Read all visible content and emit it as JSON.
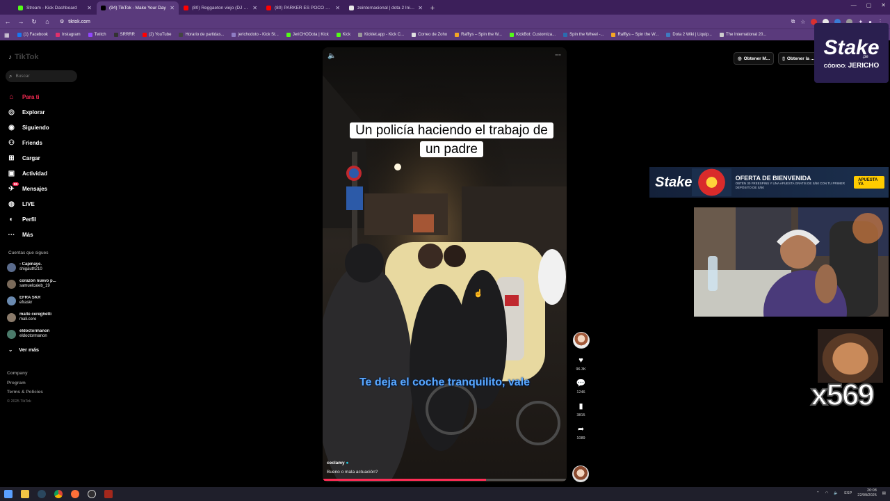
{
  "browser": {
    "tabs": [
      {
        "title": "Stream - Kick Dashboard",
        "color": "#53fc18",
        "active": false
      },
      {
        "title": "(94) TikTok - Make Your Day",
        "color": "#000000",
        "active": true
      },
      {
        "title": "(80) Reggaeton viejo (DJ Nina...",
        "color": "#ff0000",
        "active": false
      },
      {
        "title": "(80) PARKER ES POCO PROFESI...",
        "color": "#ff0000",
        "active": false
      },
      {
        "title": "zeinternacional | dota 2 Inicio",
        "color": "#e8e8e8",
        "active": false
      }
    ],
    "url": "tiktok.com",
    "bookmarks": [
      {
        "label": "(1) Facebook",
        "color": "#1877f2"
      },
      {
        "label": "Instagram",
        "color": "#e1306c"
      },
      {
        "label": "Twitch",
        "color": "#9146ff"
      },
      {
        "label": "SRRRR",
        "color": "#333333"
      },
      {
        "label": "(2) YouTube",
        "color": "#ff0000"
      },
      {
        "label": "Horario de partidas...",
        "color": "#444444"
      },
      {
        "label": "jerichodoto - Kick St...",
        "color": "#8e7cc3"
      },
      {
        "label": "JeriCHODota | Kick",
        "color": "#53fc18"
      },
      {
        "label": "Kick",
        "color": "#53fc18"
      },
      {
        "label": "Kicklet.app - Kick C...",
        "color": "#999999"
      },
      {
        "label": "Correo de Zoho",
        "color": "#e0e0e0"
      },
      {
        "label": "Rafflys – Spin the W...",
        "color": "#f5a623"
      },
      {
        "label": "KickBot: Customiza...",
        "color": "#53fc18"
      },
      {
        "label": "Spin the Wheel -...",
        "color": "#2b6cb0"
      },
      {
        "label": "Rafflys – Spin the W...",
        "color": "#f5a623"
      },
      {
        "label": "Dota 2 Wiki | Liquip...",
        "color": "#3f7ac1"
      },
      {
        "label": "The International 20...",
        "color": "#cccccc"
      }
    ]
  },
  "tiktok": {
    "logo": "TikTok",
    "search_placeholder": "Buscar",
    "nav": [
      {
        "label": "Para ti",
        "icon": "home-icon",
        "glyph": "⌂",
        "active": true
      },
      {
        "label": "Explorar",
        "icon": "compass-icon",
        "glyph": "◎",
        "active": false
      },
      {
        "label": "Siguiendo",
        "icon": "following-icon",
        "glyph": "◉",
        "active": false
      },
      {
        "label": "Friends",
        "icon": "friends-icon",
        "glyph": "⚇",
        "active": false
      },
      {
        "label": "Cargar",
        "icon": "upload-icon",
        "glyph": "⊞",
        "active": false
      },
      {
        "label": "Actividad",
        "icon": "activity-icon",
        "glyph": "▣",
        "active": false,
        "badge": ""
      },
      {
        "label": "Mensajes",
        "icon": "messages-icon",
        "glyph": "✈",
        "active": false,
        "badge": "86"
      },
      {
        "label": "LIVE",
        "icon": "live-icon",
        "glyph": "◍",
        "active": false
      },
      {
        "label": "Perfil",
        "icon": "profile-icon",
        "glyph": "◐",
        "active": false
      },
      {
        "label": "Más",
        "icon": "more-icon",
        "glyph": "···",
        "active": false
      }
    ],
    "following_title": "Cuentas que sigues",
    "following": [
      {
        "name": "- Capinaye. ᅠ",
        "handle": "shigauth210",
        "color": "#5a6b8c"
      },
      {
        "name": "corazón nuevo p...",
        "handle": "samuelcaleb_19",
        "color": "#7a6a5a"
      },
      {
        "name": "EFRA SKR",
        "handle": "efraskr",
        "color": "#6a8ab0"
      },
      {
        "name": "malte cereghetti",
        "handle": "mali.cere",
        "color": "#8a7a6a"
      },
      {
        "name": "eldoctormanon",
        "handle": "eldoctormanon",
        "color": "#4a7a6a"
      }
    ],
    "see_more": "Ver más",
    "footer": [
      "Company",
      "Program",
      "Terms & Policies"
    ],
    "copyright": "© 2025 TikTok",
    "top_buttons": [
      "Obtener M...",
      "Obtener la ..."
    ]
  },
  "video": {
    "caption_top": "Un policía haciendo el trabajo de un padre",
    "subtitle": "Te deja el coche tranquilito, vale",
    "author": "ceclamy",
    "description": "Bueno o mala actuación?",
    "progress": 0.67
  },
  "actions": {
    "likes": "96.3K",
    "comments": "1246",
    "saves": "3815",
    "shares": "1089"
  },
  "overlay": {
    "stake_brand": "Stake",
    "stake_tld": ".pe",
    "stake_code_label": "CÓDIGO:",
    "stake_code": "JERICHO",
    "banner_brand": "Stake",
    "banner_title": "OFERTA DE BIENVENIDA",
    "banner_sub": "OBTÉN 30 FREESPINS Y UNA APUESTA GRATIS DE S/50 CON TU PRIMER DEPÓSITO DE S/50",
    "banner_cta": "APUESTA YA",
    "counter": "x569"
  },
  "taskbar": {
    "lang": "ESP",
    "time": "20:08",
    "date": "22/09/2025"
  }
}
